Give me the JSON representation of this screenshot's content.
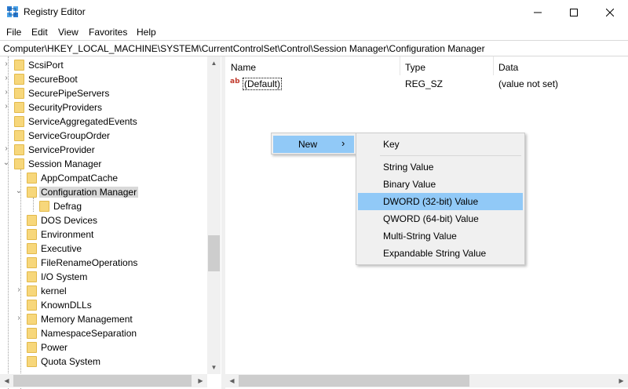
{
  "window": {
    "title": "Registry Editor",
    "minimize_glyph": "—",
    "maximize_glyph": "☐",
    "close_glyph": "✕"
  },
  "menu": [
    "File",
    "Edit",
    "View",
    "Favorites",
    "Help"
  ],
  "address": "Computer\\HKEY_LOCAL_MACHINE\\SYSTEM\\CurrentControlSet\\Control\\Session Manager\\Configuration Manager",
  "tree": {
    "items": [
      {
        "label": "ScsiPort"
      },
      {
        "label": "SecureBoot"
      },
      {
        "label": "SecurePipeServers"
      },
      {
        "label": "SecurityProviders"
      },
      {
        "label": "ServiceAggregatedEvents"
      },
      {
        "label": "ServiceGroupOrder"
      },
      {
        "label": "ServiceProvider"
      },
      {
        "label": "Session Manager"
      },
      {
        "label": "AppCompatCache"
      },
      {
        "label": "Configuration Manager"
      },
      {
        "label": "Defrag"
      },
      {
        "label": "DOS Devices"
      },
      {
        "label": "Environment"
      },
      {
        "label": "Executive"
      },
      {
        "label": "FileRenameOperations"
      },
      {
        "label": "I/O System"
      },
      {
        "label": "kernel"
      },
      {
        "label": "KnownDLLs"
      },
      {
        "label": "Memory Management"
      },
      {
        "label": "NamespaceSeparation"
      },
      {
        "label": "Power"
      },
      {
        "label": "Quota System"
      }
    ]
  },
  "columns": {
    "name": "Name",
    "type": "Type",
    "data": "Data"
  },
  "values": [
    {
      "icon": "ab",
      "name": "(Default)",
      "type": "REG_SZ",
      "data": "(value not set)"
    }
  ],
  "context_menu": {
    "new_label": "New",
    "new_arrow": "›"
  },
  "submenu": {
    "items": [
      "Key",
      "String Value",
      "Binary Value",
      "DWORD (32-bit) Value",
      "QWORD (64-bit) Value",
      "Multi-String Value",
      "Expandable String Value"
    ],
    "highlighted": "DWORD (32-bit) Value"
  },
  "colors": {
    "highlight": "#91c9f7",
    "folder": "#f7d77b",
    "menu_bg": "#f0f0f0"
  }
}
